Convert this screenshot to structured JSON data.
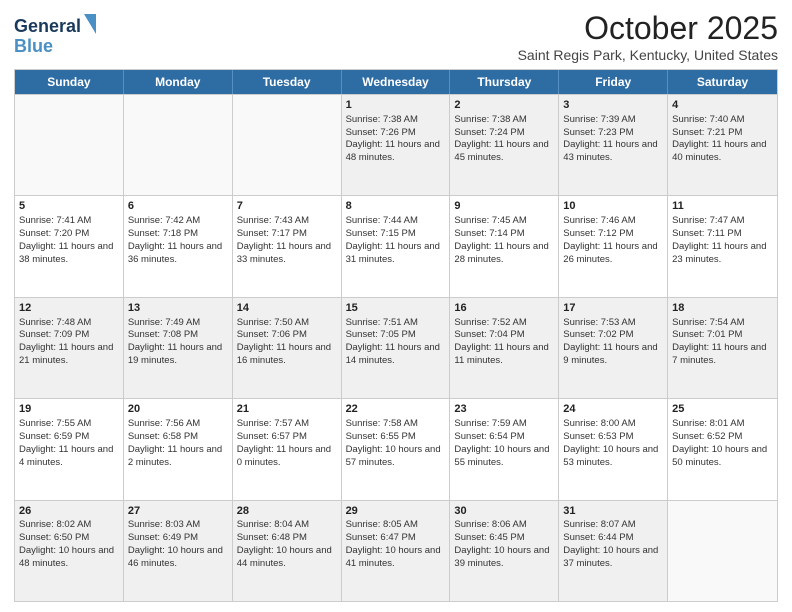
{
  "logo": {
    "line1": "General",
    "line2": "Blue"
  },
  "header": {
    "month": "October 2025",
    "location": "Saint Regis Park, Kentucky, United States"
  },
  "days": [
    "Sunday",
    "Monday",
    "Tuesday",
    "Wednesday",
    "Thursday",
    "Friday",
    "Saturday"
  ],
  "rows": [
    [
      {
        "day": "",
        "info": ""
      },
      {
        "day": "",
        "info": ""
      },
      {
        "day": "",
        "info": ""
      },
      {
        "day": "1",
        "info": "Sunrise: 7:38 AM\nSunset: 7:26 PM\nDaylight: 11 hours and 48 minutes."
      },
      {
        "day": "2",
        "info": "Sunrise: 7:38 AM\nSunset: 7:24 PM\nDaylight: 11 hours and 45 minutes."
      },
      {
        "day": "3",
        "info": "Sunrise: 7:39 AM\nSunset: 7:23 PM\nDaylight: 11 hours and 43 minutes."
      },
      {
        "day": "4",
        "info": "Sunrise: 7:40 AM\nSunset: 7:21 PM\nDaylight: 11 hours and 40 minutes."
      }
    ],
    [
      {
        "day": "5",
        "info": "Sunrise: 7:41 AM\nSunset: 7:20 PM\nDaylight: 11 hours and 38 minutes."
      },
      {
        "day": "6",
        "info": "Sunrise: 7:42 AM\nSunset: 7:18 PM\nDaylight: 11 hours and 36 minutes."
      },
      {
        "day": "7",
        "info": "Sunrise: 7:43 AM\nSunset: 7:17 PM\nDaylight: 11 hours and 33 minutes."
      },
      {
        "day": "8",
        "info": "Sunrise: 7:44 AM\nSunset: 7:15 PM\nDaylight: 11 hours and 31 minutes."
      },
      {
        "day": "9",
        "info": "Sunrise: 7:45 AM\nSunset: 7:14 PM\nDaylight: 11 hours and 28 minutes."
      },
      {
        "day": "10",
        "info": "Sunrise: 7:46 AM\nSunset: 7:12 PM\nDaylight: 11 hours and 26 minutes."
      },
      {
        "day": "11",
        "info": "Sunrise: 7:47 AM\nSunset: 7:11 PM\nDaylight: 11 hours and 23 minutes."
      }
    ],
    [
      {
        "day": "12",
        "info": "Sunrise: 7:48 AM\nSunset: 7:09 PM\nDaylight: 11 hours and 21 minutes."
      },
      {
        "day": "13",
        "info": "Sunrise: 7:49 AM\nSunset: 7:08 PM\nDaylight: 11 hours and 19 minutes."
      },
      {
        "day": "14",
        "info": "Sunrise: 7:50 AM\nSunset: 7:06 PM\nDaylight: 11 hours and 16 minutes."
      },
      {
        "day": "15",
        "info": "Sunrise: 7:51 AM\nSunset: 7:05 PM\nDaylight: 11 hours and 14 minutes."
      },
      {
        "day": "16",
        "info": "Sunrise: 7:52 AM\nSunset: 7:04 PM\nDaylight: 11 hours and 11 minutes."
      },
      {
        "day": "17",
        "info": "Sunrise: 7:53 AM\nSunset: 7:02 PM\nDaylight: 11 hours and 9 minutes."
      },
      {
        "day": "18",
        "info": "Sunrise: 7:54 AM\nSunset: 7:01 PM\nDaylight: 11 hours and 7 minutes."
      }
    ],
    [
      {
        "day": "19",
        "info": "Sunrise: 7:55 AM\nSunset: 6:59 PM\nDaylight: 11 hours and 4 minutes."
      },
      {
        "day": "20",
        "info": "Sunrise: 7:56 AM\nSunset: 6:58 PM\nDaylight: 11 hours and 2 minutes."
      },
      {
        "day": "21",
        "info": "Sunrise: 7:57 AM\nSunset: 6:57 PM\nDaylight: 11 hours and 0 minutes."
      },
      {
        "day": "22",
        "info": "Sunrise: 7:58 AM\nSunset: 6:55 PM\nDaylight: 10 hours and 57 minutes."
      },
      {
        "day": "23",
        "info": "Sunrise: 7:59 AM\nSunset: 6:54 PM\nDaylight: 10 hours and 55 minutes."
      },
      {
        "day": "24",
        "info": "Sunrise: 8:00 AM\nSunset: 6:53 PM\nDaylight: 10 hours and 53 minutes."
      },
      {
        "day": "25",
        "info": "Sunrise: 8:01 AM\nSunset: 6:52 PM\nDaylight: 10 hours and 50 minutes."
      }
    ],
    [
      {
        "day": "26",
        "info": "Sunrise: 8:02 AM\nSunset: 6:50 PM\nDaylight: 10 hours and 48 minutes."
      },
      {
        "day": "27",
        "info": "Sunrise: 8:03 AM\nSunset: 6:49 PM\nDaylight: 10 hours and 46 minutes."
      },
      {
        "day": "28",
        "info": "Sunrise: 8:04 AM\nSunset: 6:48 PM\nDaylight: 10 hours and 44 minutes."
      },
      {
        "day": "29",
        "info": "Sunrise: 8:05 AM\nSunset: 6:47 PM\nDaylight: 10 hours and 41 minutes."
      },
      {
        "day": "30",
        "info": "Sunrise: 8:06 AM\nSunset: 6:45 PM\nDaylight: 10 hours and 39 minutes."
      },
      {
        "day": "31",
        "info": "Sunrise: 8:07 AM\nSunset: 6:44 PM\nDaylight: 10 hours and 37 minutes."
      },
      {
        "day": "",
        "info": ""
      }
    ]
  ]
}
